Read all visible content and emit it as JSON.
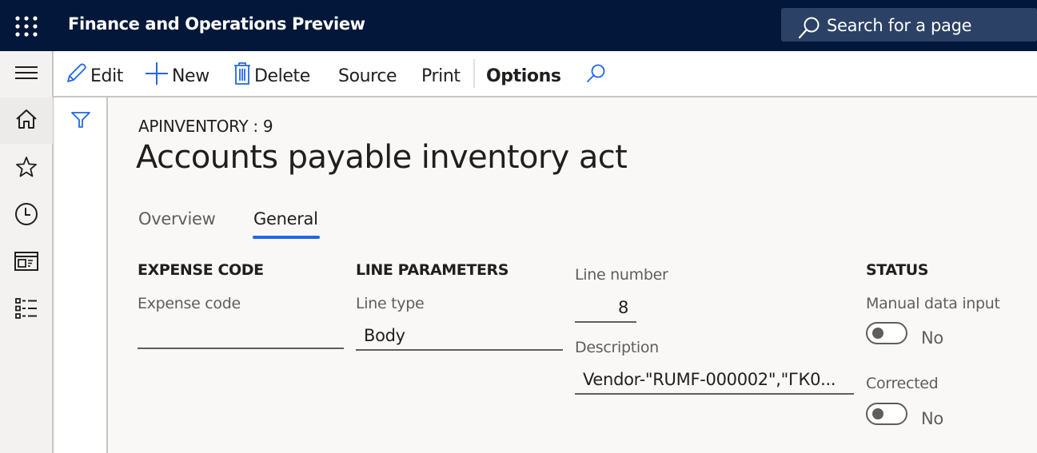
{
  "topbar": {
    "app_title": "Finance and Operations Preview",
    "search_placeholder": "Search for a page",
    "background_color": "#021739"
  },
  "nav_rail": {
    "items": [
      {
        "name": "home",
        "icon": "home-icon",
        "active": true
      },
      {
        "name": "favorites",
        "icon": "star-icon"
      },
      {
        "name": "recent",
        "icon": "clock-icon"
      },
      {
        "name": "workspaces",
        "icon": "workspace-icon"
      },
      {
        "name": "modules",
        "icon": "list-icon"
      }
    ]
  },
  "actions": {
    "edit": "Edit",
    "new": "New",
    "delete": "Delete",
    "source": "Source",
    "print": "Print",
    "options": "Options",
    "accent_color": "#2266e3"
  },
  "page": {
    "breadcrumb": "APINVENTORY : 9",
    "title": "Accounts payable inventory act"
  },
  "tabs": [
    {
      "label": "Overview",
      "active": false
    },
    {
      "label": "General",
      "active": true
    }
  ],
  "groups": {
    "expense_code": {
      "title": "EXPENSE CODE",
      "fields": {
        "expense_code": {
          "label": "Expense code",
          "value": ""
        }
      }
    },
    "line_parameters": {
      "title": "LINE PARAMETERS",
      "fields": {
        "line_type": {
          "label": "Line type",
          "value": "Body"
        },
        "line_number": {
          "label": "Line number",
          "value": "8"
        },
        "description": {
          "label": "Description",
          "value": "Vendor-\"RUMF-000002\",\"ГК0..."
        }
      }
    },
    "status": {
      "title": "STATUS",
      "fields": {
        "manual_data_input": {
          "label": "Manual data input",
          "value": "No",
          "on": false
        },
        "corrected": {
          "label": "Corrected",
          "value": "No",
          "on": false
        }
      }
    }
  }
}
